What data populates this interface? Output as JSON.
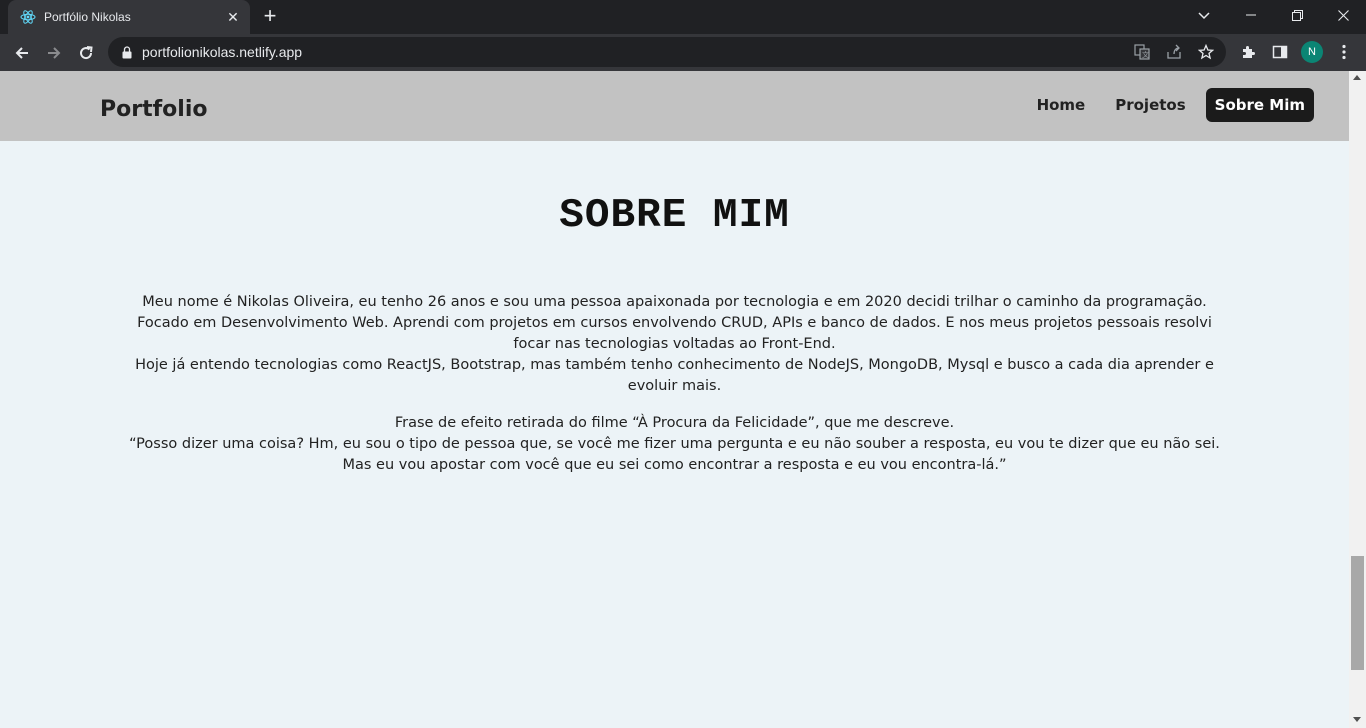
{
  "browser": {
    "tab_title": "Portfólio Nikolas",
    "url": "portfolionikolas.netlify.app",
    "profile_initial": "N",
    "colors": {
      "frame": "#202124",
      "toolbar": "#35363a",
      "avatar": "#0b8574"
    }
  },
  "site": {
    "brand": "Portfolio",
    "nav": [
      {
        "label": "Home",
        "active": false
      },
      {
        "label": "Projetos",
        "active": false
      },
      {
        "label": "Sobre Mim",
        "active": true
      }
    ],
    "colors": {
      "navbar_bg": "#c2c2c2",
      "page_bg": "#ecf3f7",
      "active_bg": "#1b1b1b"
    }
  },
  "about": {
    "title": "SOBRE MIM",
    "paragraph1": "Meu nome é Nikolas Oliveira, eu tenho 26 anos e sou uma pessoa apaixonada por tecnologia e em 2020 decidi trilhar o caminho da programação. Focado em Desenvolvimento Web. Aprendi com projetos em cursos envolvendo CRUD, APIs e banco de dados. E nos meus projetos pessoais resolvi focar nas tecnologias voltadas ao Front-End.",
    "paragraph2": "Hoje já entendo tecnologias como ReactJS, Bootstrap, mas também tenho conhecimento de NodeJS, MongoDB, Mysql e busco a cada dia aprender e evoluir mais.",
    "quote_intro": "Frase de efeito retirada do filme “À Procura da Felicidade”, que me descreve.",
    "quote": "“Posso dizer uma coisa? Hm, eu sou o tipo de pessoa que, se você me fizer uma pergunta e eu não souber a resposta, eu vou te dizer que eu não sei. Mas eu vou apostar com você que eu sei como encontrar a resposta e eu vou encontra-lá.”"
  }
}
